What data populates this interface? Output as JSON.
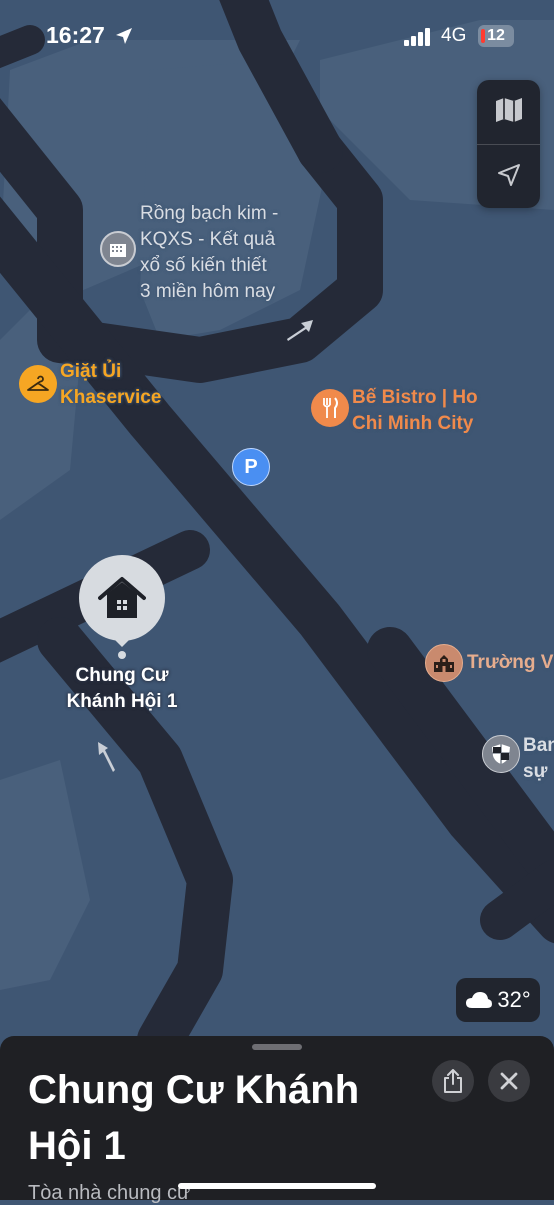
{
  "status_bar": {
    "time": "16:27",
    "network": "4G",
    "battery": "12"
  },
  "map_controls": {
    "map_mode_icon": "map-icon",
    "locate_icon": "location-arrow-icon"
  },
  "pois": {
    "rong_bach_kim": [
      "Rồng bạch kim -",
      "KQXS - Kết quả",
      "xổ số kiến thiết",
      "3 miền hôm nay"
    ],
    "giat_ui": [
      "Giặt Ủi",
      "Khaservice"
    ],
    "be_bistro": [
      "Bế Bistro | Ho",
      "Chi Minh City"
    ],
    "parking": "P",
    "selected": [
      "Chung Cư",
      "Khánh Hội 1"
    ],
    "truong": "Trường V",
    "ban": [
      "Ban",
      "sự"
    ]
  },
  "weather": {
    "icon": "cloud-icon",
    "temperature": "32°"
  },
  "sheet": {
    "title": "Chung Cư Khánh Hội 1",
    "subtitle": "Tòa nhà chung cư",
    "share_icon": "share-icon",
    "close_icon": "close-icon"
  },
  "colors": {
    "map_background": "#3f5673",
    "road": "#252a38",
    "orange_poi": "#f6a623",
    "restaurant_poi": "#f08a4b",
    "parking_poi": "#4a8ff2"
  }
}
